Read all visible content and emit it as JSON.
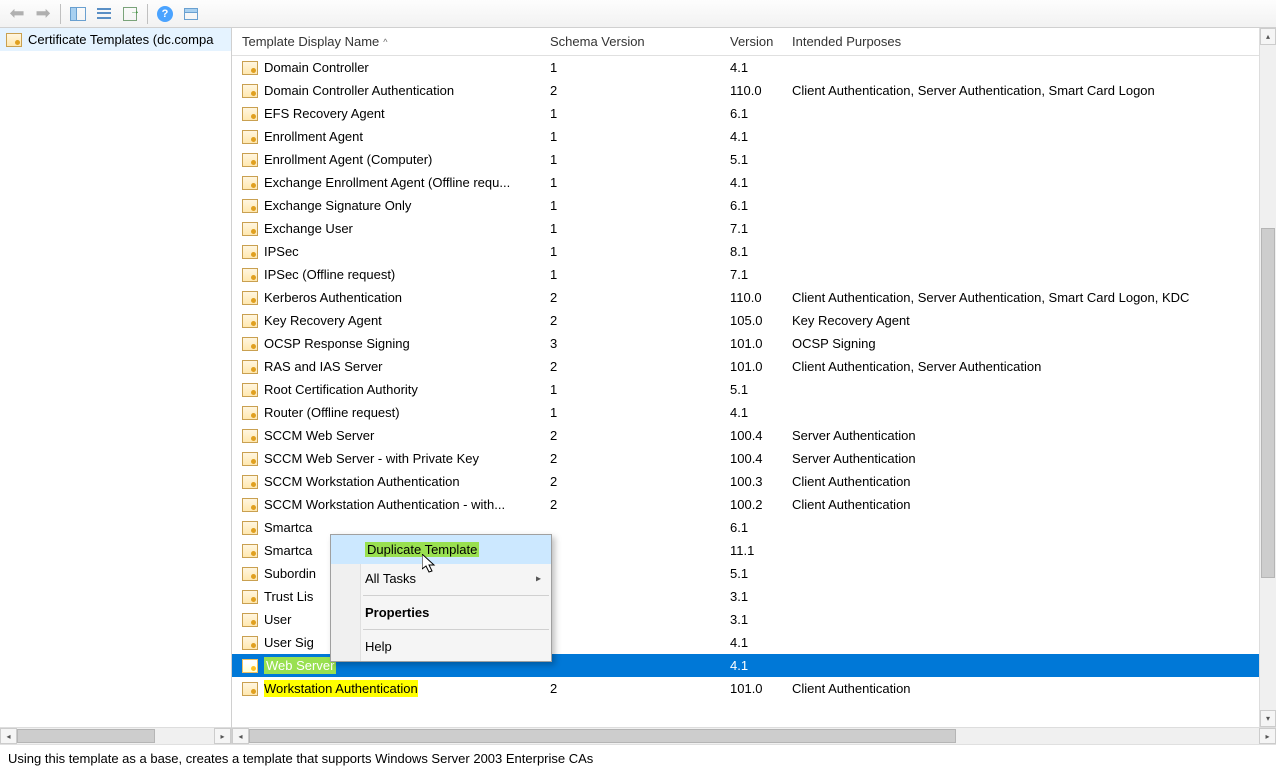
{
  "toolbar": {},
  "tree": {
    "root": "Certificate Templates (dc.compa"
  },
  "columns": {
    "name": "Template Display Name",
    "schema": "Schema Version",
    "version": "Version",
    "purposes": "Intended Purposes"
  },
  "rows": [
    {
      "name": "Domain Controller",
      "schema": "1",
      "version": "4.1",
      "purposes": ""
    },
    {
      "name": "Domain Controller Authentication",
      "schema": "2",
      "version": "110.0",
      "purposes": "Client Authentication, Server Authentication, Smart Card Logon"
    },
    {
      "name": "EFS Recovery Agent",
      "schema": "1",
      "version": "6.1",
      "purposes": ""
    },
    {
      "name": "Enrollment Agent",
      "schema": "1",
      "version": "4.1",
      "purposes": ""
    },
    {
      "name": "Enrollment Agent (Computer)",
      "schema": "1",
      "version": "5.1",
      "purposes": ""
    },
    {
      "name": "Exchange Enrollment Agent (Offline requ...",
      "schema": "1",
      "version": "4.1",
      "purposes": ""
    },
    {
      "name": "Exchange Signature Only",
      "schema": "1",
      "version": "6.1",
      "purposes": ""
    },
    {
      "name": "Exchange User",
      "schema": "1",
      "version": "7.1",
      "purposes": ""
    },
    {
      "name": "IPSec",
      "schema": "1",
      "version": "8.1",
      "purposes": ""
    },
    {
      "name": "IPSec (Offline request)",
      "schema": "1",
      "version": "7.1",
      "purposes": ""
    },
    {
      "name": "Kerberos Authentication",
      "schema": "2",
      "version": "110.0",
      "purposes": "Client Authentication, Server Authentication, Smart Card Logon, KDC"
    },
    {
      "name": "Key Recovery Agent",
      "schema": "2",
      "version": "105.0",
      "purposes": "Key Recovery Agent"
    },
    {
      "name": "OCSP Response Signing",
      "schema": "3",
      "version": "101.0",
      "purposes": "OCSP Signing"
    },
    {
      "name": "RAS and IAS Server",
      "schema": "2",
      "version": "101.0",
      "purposes": "Client Authentication, Server Authentication"
    },
    {
      "name": "Root Certification Authority",
      "schema": "1",
      "version": "5.1",
      "purposes": ""
    },
    {
      "name": "Router (Offline request)",
      "schema": "1",
      "version": "4.1",
      "purposes": ""
    },
    {
      "name": "SCCM Web Server",
      "schema": "2",
      "version": "100.4",
      "purposes": "Server Authentication"
    },
    {
      "name": "SCCM Web Server - with Private Key",
      "schema": "2",
      "version": "100.4",
      "purposes": "Server Authentication"
    },
    {
      "name": "SCCM Workstation Authentication",
      "schema": "2",
      "version": "100.3",
      "purposes": "Client Authentication"
    },
    {
      "name": "SCCM Workstation Authentication - with...",
      "schema": "2",
      "version": "100.2",
      "purposes": "Client Authentication"
    },
    {
      "name": "Smartca",
      "schema": "",
      "version": "6.1",
      "purposes": ""
    },
    {
      "name": "Smartca",
      "schema": "",
      "version": "11.1",
      "purposes": ""
    },
    {
      "name": "Subordin",
      "schema": "",
      "version": "5.1",
      "purposes": ""
    },
    {
      "name": "Trust Lis",
      "schema": "",
      "version": "3.1",
      "purposes": ""
    },
    {
      "name": "User",
      "schema": "",
      "version": "3.1",
      "purposes": ""
    },
    {
      "name": "User Sig",
      "schema": "",
      "version": "4.1",
      "purposes": ""
    },
    {
      "name": "Web Server",
      "schema": "",
      "version": "4.1",
      "purposes": "",
      "selected": true,
      "highlighted": true
    },
    {
      "name": "Workstation Authentication",
      "schema": "2",
      "version": "101.0",
      "purposes": "Client Authentication",
      "highlighted": true
    }
  ],
  "context_menu": {
    "duplicate": "Duplicate Template",
    "all_tasks": "All Tasks",
    "properties": "Properties",
    "help": "Help"
  },
  "status": "Using this template as a base, creates a template that supports Windows Server 2003 Enterprise CAs"
}
